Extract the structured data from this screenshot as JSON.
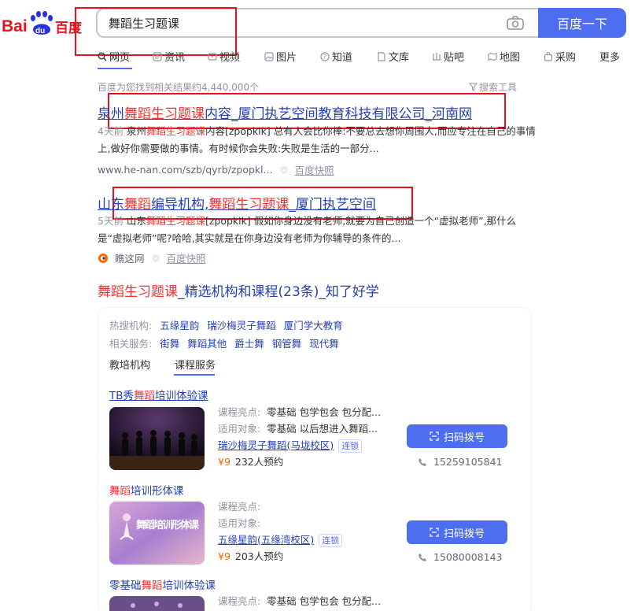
{
  "logo": {
    "text_bai": "Bai",
    "text_du": "du",
    "text_cn": "百度"
  },
  "search": {
    "query": "舞蹈生习题课",
    "button_label": "百度一下"
  },
  "tabs": [
    {
      "label": "网页",
      "icon": "search-icon"
    },
    {
      "label": "资讯",
      "icon": "news-icon"
    },
    {
      "label": "视频",
      "icon": "video-icon"
    },
    {
      "label": "图片",
      "icon": "image-icon"
    },
    {
      "label": "知道",
      "icon": "question-icon"
    },
    {
      "label": "文库",
      "icon": "doc-icon"
    },
    {
      "label": "贴吧",
      "icon": "tieba-icon"
    },
    {
      "label": "地图",
      "icon": "map-icon"
    },
    {
      "label": "采购",
      "icon": "purchase-icon"
    },
    {
      "label": "更多",
      "icon": ""
    }
  ],
  "stats": {
    "text": "百度为您找到相关结果约4,440,000个",
    "tools_label": "搜索工具"
  },
  "results": [
    {
      "title_pre": "泉州",
      "title_em": "舞蹈生习题课",
      "title_post": "内容_厦门执艺空间教育科技有限公司_河南网",
      "age": "4天前",
      "snippet_a": " 泉州",
      "snippet_em": "舞蹈生习题课",
      "snippet_b": "内容[zpopklk] 总有人会比你棒:不要总去想你周围人,而应专注在自己的事情上,做好你需要做的事情。有时候你会失败:失败是生活的一部分...",
      "url": "www.he-nan.com/szb/qyrb/zpopkl...",
      "kuaizhao": "百度快照"
    },
    {
      "title_pre": "山东",
      "title_em": "舞蹈",
      "title_mid": "编导机构,",
      "title_em2": "舞蹈生习题课",
      "title_post": "_厦门执艺空间",
      "age": "5天前",
      "snippet_a": " 山东",
      "snippet_em": "舞蹈生习题课",
      "snippet_b": "[zpopklk] 假如你身边没有老师,就要为自己创造一个“虚拟老师”,那什么是“虚拟老师”呢?哈哈,其实就是在你身边没有老师为你辅导的条件的...",
      "source": "瞧这网",
      "kuaizhao": "百度快照"
    }
  ],
  "rich": {
    "title_em": "舞蹈生习题课",
    "title_post": "_精选机构和课程(23条)_知了好学",
    "hot_label": "热搜机构:",
    "hot": [
      "五缘星韵",
      "瑞沙梅灵子舞蹈",
      "厦门学大教育"
    ],
    "related_label": "相关服务:",
    "related": [
      "街舞",
      "舞蹈其他",
      "爵士舞",
      "钢管舞",
      "现代舞"
    ],
    "subtabs": [
      "教培机构",
      "课程服务"
    ],
    "courses": [
      {
        "title_pre": "TB秀",
        "title_em": "舞蹈",
        "title_post": "培训体验课",
        "k1": "课程亮点:",
        "v1": "零基础 包学包会 包分配...",
        "k2": "适用对象:",
        "v2": "零基础 以后想进入舞蹈...",
        "org": "瑞沙梅灵子舞蹈(马垅校区)",
        "chain": "连锁",
        "price": "¥9",
        "booked": "232人预约",
        "call": "扫码拨号",
        "phone": "15259105841"
      },
      {
        "title_pre": "",
        "title_em": "舞蹈",
        "title_post": "培训形体课",
        "k1": "课程亮点:",
        "v1": "",
        "k2": "适用对象:",
        "v2": "",
        "org": "五缘星韵(五缘湾校区)",
        "chain": "连锁",
        "price": "¥9",
        "booked": "203人预约",
        "call": "扫码拨号",
        "phone": "15080008143",
        "thumb_text": "舞蹈培训形体课"
      },
      {
        "title_pre": "零基础",
        "title_em": "舞蹈",
        "title_post": "培训体验课",
        "k1": "课程亮点:",
        "v1": "零基础 包学包会 包分配..."
      }
    ]
  },
  "colors": {
    "accent": "#4e6ef2",
    "link": "#2440b3",
    "highlight": "#f73131",
    "annotation": "#e8121e"
  }
}
